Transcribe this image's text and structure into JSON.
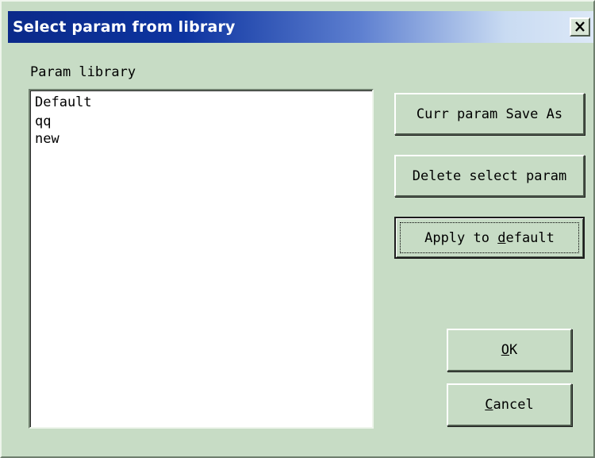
{
  "window": {
    "title": "Select param from library",
    "close_icon": "close-icon"
  },
  "library": {
    "label": "Param library",
    "items": [
      "Default",
      "qq",
      "new"
    ]
  },
  "buttons": {
    "save_as": "Curr param Save As",
    "delete": "Delete select param",
    "apply_prefix": "Apply to ",
    "apply_mnemonic": "d",
    "apply_suffix": "efault",
    "ok_mnemonic": "O",
    "ok_suffix": "K",
    "cancel_mnemonic": "C",
    "cancel_suffix": "ancel"
  },
  "colors": {
    "dialog_background": "#c7dcc5",
    "titlebar_start": "#0b2a8a",
    "titlebar_end": "#dce8f7"
  }
}
